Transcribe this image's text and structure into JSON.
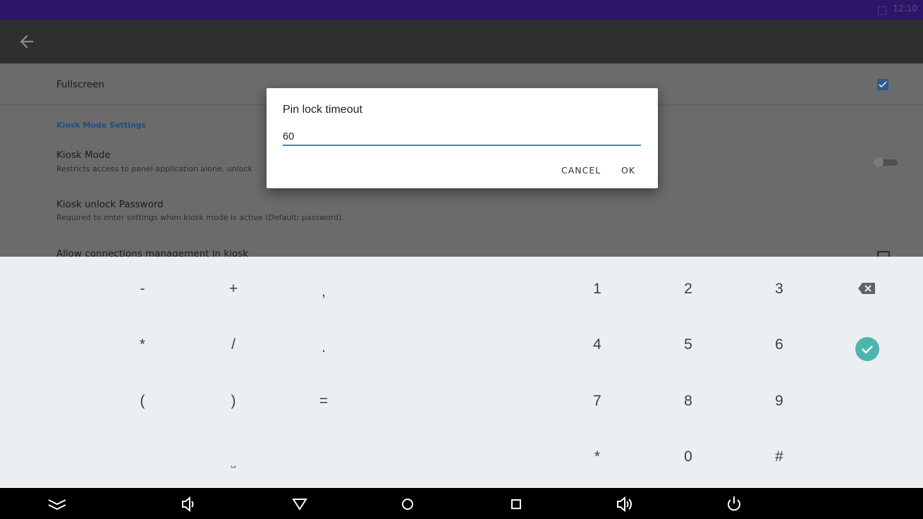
{
  "status_bar": {
    "time": "12:10"
  },
  "settings": {
    "fullscreen": {
      "title": "Fullscreen",
      "checked": true
    },
    "section_header": "Kiosk Mode Settings",
    "kiosk_mode": {
      "title": "Kiosk Mode",
      "summary": "Restricts access to panel application alone, unlock"
    },
    "kiosk_password": {
      "title": "Kiosk unlock Password",
      "summary": "Required to enter settings when kiosk mode is active (Default: password)."
    },
    "allow_connections": {
      "title": "Allow connections management in kiosk"
    }
  },
  "dialog": {
    "title": "Pin lock timeout",
    "value": "60",
    "cancel_label": "CANCEL",
    "ok_label": "OK"
  },
  "keyboard": {
    "symbols": [
      [
        "-",
        "+",
        ","
      ],
      [
        "*",
        "/",
        "."
      ],
      [
        "(",
        ")",
        "="
      ],
      [
        "",
        "⎵",
        ""
      ]
    ],
    "digits": [
      [
        "1",
        "2",
        "3"
      ],
      [
        "4",
        "5",
        "6"
      ],
      [
        "7",
        "8",
        "9"
      ],
      [
        "*",
        "0",
        "#"
      ]
    ],
    "delete_icon": "backspace-icon",
    "enter_icon": "check-icon"
  },
  "navbar": {
    "icons": [
      "collapse-keyboard-icon",
      "volume-down-icon",
      "back-icon",
      "home-icon",
      "recents-icon",
      "volume-up-icon",
      "power-icon"
    ]
  },
  "colors": {
    "status_bar": "#2c1667",
    "app_bar": "#2f2f2f",
    "accent": "#2b8fd0",
    "enter_key": "#4db6ac"
  }
}
